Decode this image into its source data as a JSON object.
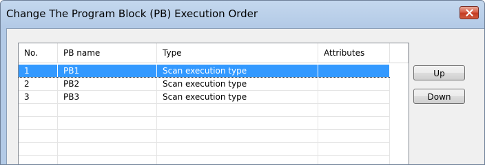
{
  "window": {
    "title": "Change The Program Block (PB) Execution Order"
  },
  "list": {
    "columns": [
      "No.",
      "PB name",
      "Type",
      "Attributes"
    ],
    "rows": [
      {
        "no": "1",
        "name": "PB1",
        "type": "Scan execution type",
        "attributes": "",
        "selected": true
      },
      {
        "no": "2",
        "name": "PB2",
        "type": "Scan execution type",
        "attributes": "",
        "selected": false
      },
      {
        "no": "3",
        "name": "PB3",
        "type": "Scan execution type",
        "attributes": "",
        "selected": false
      }
    ]
  },
  "buttons": {
    "up_label": "Up",
    "down_label": "Down"
  },
  "colors": {
    "selection": "#3399ff",
    "title_bar": "#b3cae6"
  }
}
